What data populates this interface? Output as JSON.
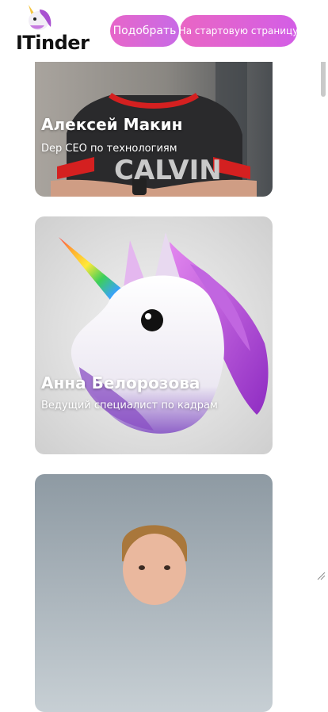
{
  "header": {
    "logo_text": "ITinder",
    "pick_button": "Подобрать",
    "home_button": "На стартовую страницу"
  },
  "cards": [
    {
      "name": "Алексей Макин",
      "role": "Dep CEO по технологиям",
      "shirt_text": "CALVIN"
    },
    {
      "name": "Анна Белорозова",
      "role": "Ведущий специалист по кадрам"
    },
    {
      "name": "",
      "role": ""
    }
  ],
  "colors": {
    "button_pink": "#e766c9",
    "button_violet": "#c86ae6",
    "unicorn_mane": "#b84fd6"
  }
}
